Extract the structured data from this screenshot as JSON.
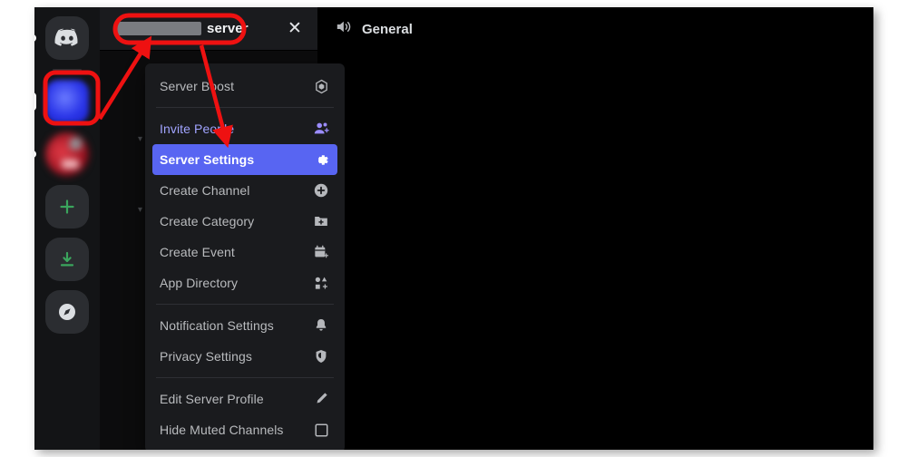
{
  "window": {
    "title_bar": {
      "server_name_redacted": true,
      "server_name_visible_text": "server",
      "close_label": "✕"
    }
  },
  "server_rail": {
    "items": [
      {
        "name": "discord-home",
        "type": "home",
        "label": "Home"
      },
      {
        "name": "server-blue-redacted",
        "type": "blurred-blue",
        "label": "",
        "selected": true
      },
      {
        "name": "server-red-redacted",
        "type": "blurred-red",
        "label": ""
      },
      {
        "name": "add-server",
        "type": "action",
        "label": "+"
      },
      {
        "name": "download-apps",
        "type": "action",
        "label": "↓"
      },
      {
        "name": "explore-servers",
        "type": "action",
        "label": ""
      }
    ]
  },
  "server_menu": {
    "groups": [
      {
        "items": [
          {
            "label": "Server Boost",
            "icon": "boost-gem-icon",
            "state": "normal"
          }
        ]
      },
      {
        "items": [
          {
            "label": "Invite People",
            "icon": "person-add-icon",
            "state": "invite"
          },
          {
            "label": "Server Settings",
            "icon": "gear-icon",
            "state": "active"
          },
          {
            "label": "Create Channel",
            "icon": "plus-circle-icon",
            "state": "normal"
          },
          {
            "label": "Create Category",
            "icon": "folder-plus-icon",
            "state": "normal"
          },
          {
            "label": "Create Event",
            "icon": "calendar-plus-icon",
            "state": "normal"
          },
          {
            "label": "App Directory",
            "icon": "app-grid-icon",
            "state": "normal"
          }
        ]
      },
      {
        "items": [
          {
            "label": "Notification Settings",
            "icon": "bell-icon",
            "state": "normal"
          },
          {
            "label": "Privacy Settings",
            "icon": "shield-icon",
            "state": "normal"
          }
        ]
      },
      {
        "items": [
          {
            "label": "Edit Server Profile",
            "icon": "pencil-icon",
            "state": "normal"
          },
          {
            "label": "Hide Muted Channels",
            "icon": "checkbox-empty-icon",
            "state": "normal"
          }
        ]
      }
    ]
  },
  "main": {
    "channel_header": {
      "icon": "voice-speaker-icon",
      "name": "General"
    }
  },
  "annotations": {
    "highlight_box_label": "blue-server-icon-highlight",
    "name_pill_label": "server-name-highlight",
    "arrows": [
      {
        "from": "blue-server-icon",
        "to": "server-name-pill"
      },
      {
        "from": "server-name-pill",
        "to": "server-settings-item"
      }
    ],
    "color": "#ee1111"
  },
  "colors": {
    "accent_blurple": "#5865f2",
    "menu_bg": "#1a1b1e",
    "rail_bg": "#131416",
    "sidebar_bg": "#0c0c0d",
    "content_bg": "#000000",
    "annotation_red": "#ee1111",
    "invite_text": "#a1a4ff"
  }
}
